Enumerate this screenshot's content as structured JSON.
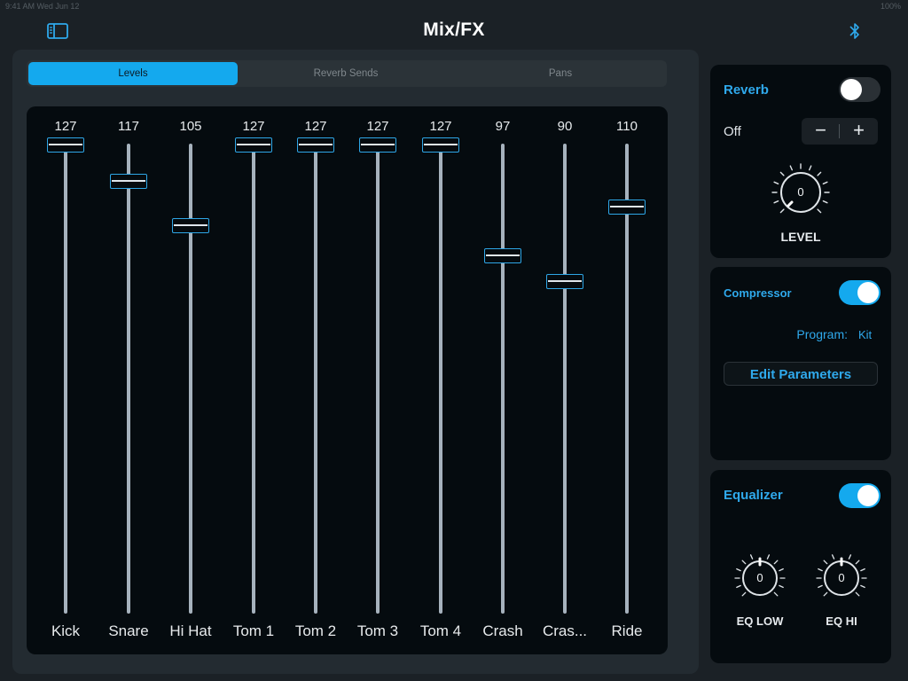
{
  "status_bar": {
    "left_text": "9:41 AM  Wed Jun 12",
    "right_text": "100%"
  },
  "nav": {
    "title": "Mix/FX"
  },
  "tabs": [
    {
      "label": "Levels",
      "active": true
    },
    {
      "label": "Reverb Sends",
      "active": false
    },
    {
      "label": "Pans",
      "active": false
    }
  ],
  "channels": [
    {
      "label": "Kick",
      "value": "127",
      "level": 127
    },
    {
      "label": "Snare",
      "value": "117",
      "level": 117
    },
    {
      "label": "Hi Hat",
      "value": "105",
      "level": 105
    },
    {
      "label": "Tom 1",
      "value": "127",
      "level": 127
    },
    {
      "label": "Tom 2",
      "value": "127",
      "level": 127
    },
    {
      "label": "Tom 3",
      "value": "127",
      "level": 127
    },
    {
      "label": "Tom 4",
      "value": "127",
      "level": 127
    },
    {
      "label": "Crash",
      "value": "97",
      "level": 97
    },
    {
      "label": "Cras...",
      "value": "90",
      "level": 90
    },
    {
      "label": "Ride",
      "value": "110",
      "level": 110
    }
  ],
  "reverb": {
    "title": "Reverb",
    "enabled": false,
    "preset_value": "Off",
    "minus_label": "−",
    "plus_label": "+",
    "knob_value": "0",
    "knob_label": "LEVEL"
  },
  "compressor": {
    "title": "Compressor",
    "enabled": true,
    "program_label": "Program:",
    "program_value": "Kit",
    "edit_button": "Edit Parameters"
  },
  "equalizer": {
    "title": "Equalizer",
    "enabled": true,
    "low_value": "0",
    "low_label": "EQ LOW",
    "hi_value": "0",
    "hi_label": "EQ HI"
  },
  "colors": {
    "accent": "#14a9ee",
    "accent_text": "#2fa9ec",
    "background": "#1b2126",
    "panel": "#050b0f"
  },
  "icons": {
    "sidebar": "sidebar-icon",
    "bluetooth": "bluetooth-icon"
  }
}
